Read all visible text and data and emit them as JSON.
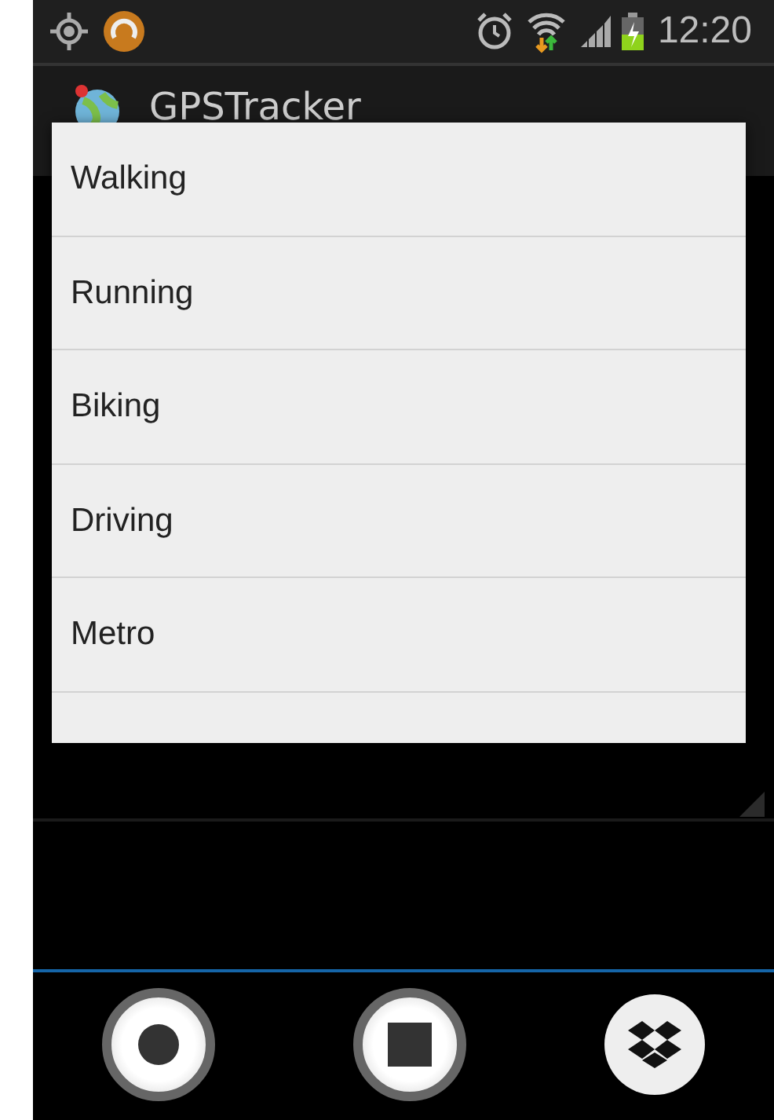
{
  "status_bar": {
    "time": "12:20"
  },
  "app_bar": {
    "title": "GPSTracker"
  },
  "dropdown": {
    "items": [
      {
        "label": "Walking"
      },
      {
        "label": "Running"
      },
      {
        "label": "Biking"
      },
      {
        "label": "Driving"
      },
      {
        "label": "Metro"
      }
    ]
  },
  "bottom_buttons": [
    {
      "kind": "record"
    },
    {
      "kind": "stop"
    },
    {
      "kind": "dropbox"
    }
  ]
}
